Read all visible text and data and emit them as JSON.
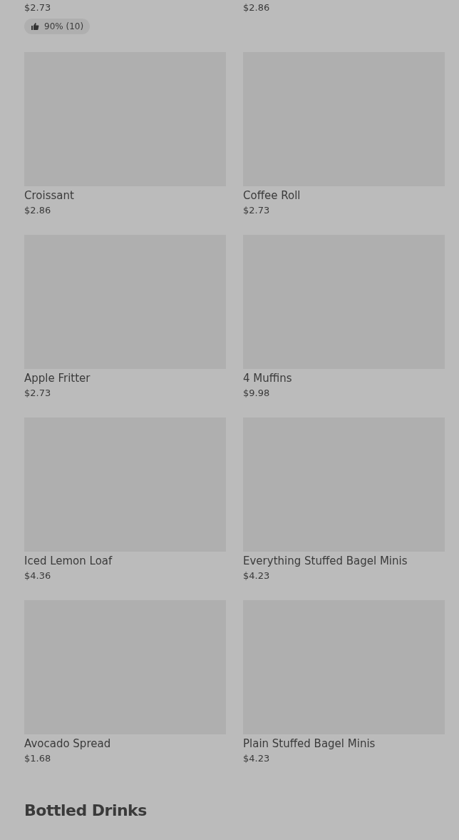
{
  "top_items": [
    {
      "price": "$2.73",
      "rating": "90% (10)"
    },
    {
      "price": "$2.86"
    }
  ],
  "items": [
    {
      "name": "Croissant",
      "price": "$2.86"
    },
    {
      "name": "Coffee Roll",
      "price": "$2.73"
    },
    {
      "name": "Apple Fritter",
      "price": "$2.73"
    },
    {
      "name": "4 Muffins",
      "price": "$9.98"
    },
    {
      "name": "Iced Lemon Loaf",
      "price": "$4.36"
    },
    {
      "name": "Everything Stuffed Bagel Minis",
      "price": "$4.23"
    },
    {
      "name": "Avocado Spread",
      "price": "$1.68"
    },
    {
      "name": "Plain Stuffed Bagel Minis",
      "price": "$4.23"
    }
  ],
  "next_section": {
    "title": "Bottled Drinks"
  }
}
